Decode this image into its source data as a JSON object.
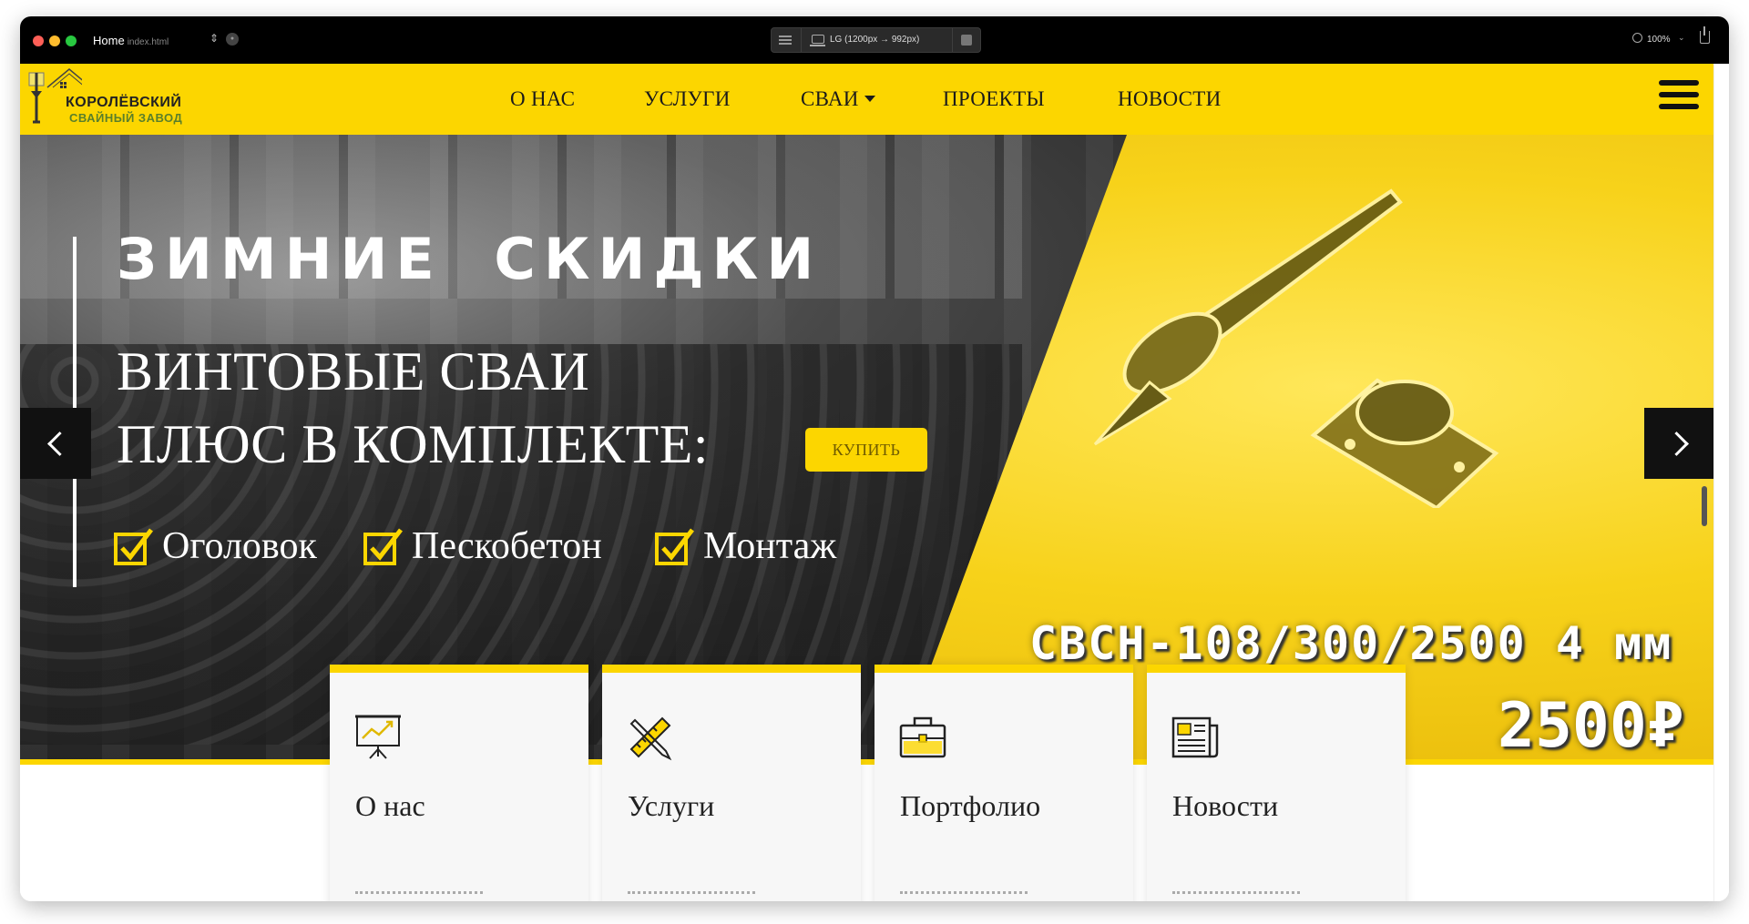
{
  "browser": {
    "tab_title": "Home",
    "tab_file": "index.html",
    "viewport_label": "LG (1200px → 992px)",
    "zoom": "100%"
  },
  "logo": {
    "line1": "КОРОЛЁВСКИЙ",
    "line2": "СВАЙНЫЙ ЗАВОД"
  },
  "nav": {
    "items": [
      {
        "label": "О НАС"
      },
      {
        "label": "УСЛУГИ"
      },
      {
        "label": "СВАИ"
      },
      {
        "label": "ПРОЕКТЫ"
      },
      {
        "label": "НОВОСТИ"
      }
    ]
  },
  "hero": {
    "headline": "ЗИМНИЕ СКИДКИ",
    "line1": "ВИНТОВЫЕ СВАИ",
    "line2": "ПЛЮС В КОМПЛЕКТЕ:",
    "buy_label": "КУПИТЬ",
    "features": [
      "Оголовок",
      "Пескобетон",
      "Монтаж"
    ],
    "product": "СВСН-108/300/2500 4 мм",
    "price": "2500₽"
  },
  "cards": [
    {
      "title": "О нас",
      "icon": "presentation-chart-icon"
    },
    {
      "title": "Услуги",
      "icon": "pencil-ruler-icon"
    },
    {
      "title": "Портфолио",
      "icon": "briefcase-icon"
    },
    {
      "title": "Новости",
      "icon": "newspaper-icon"
    }
  ],
  "colors": {
    "accent": "#fcd600",
    "dark": "#111111",
    "text": "#222222"
  }
}
